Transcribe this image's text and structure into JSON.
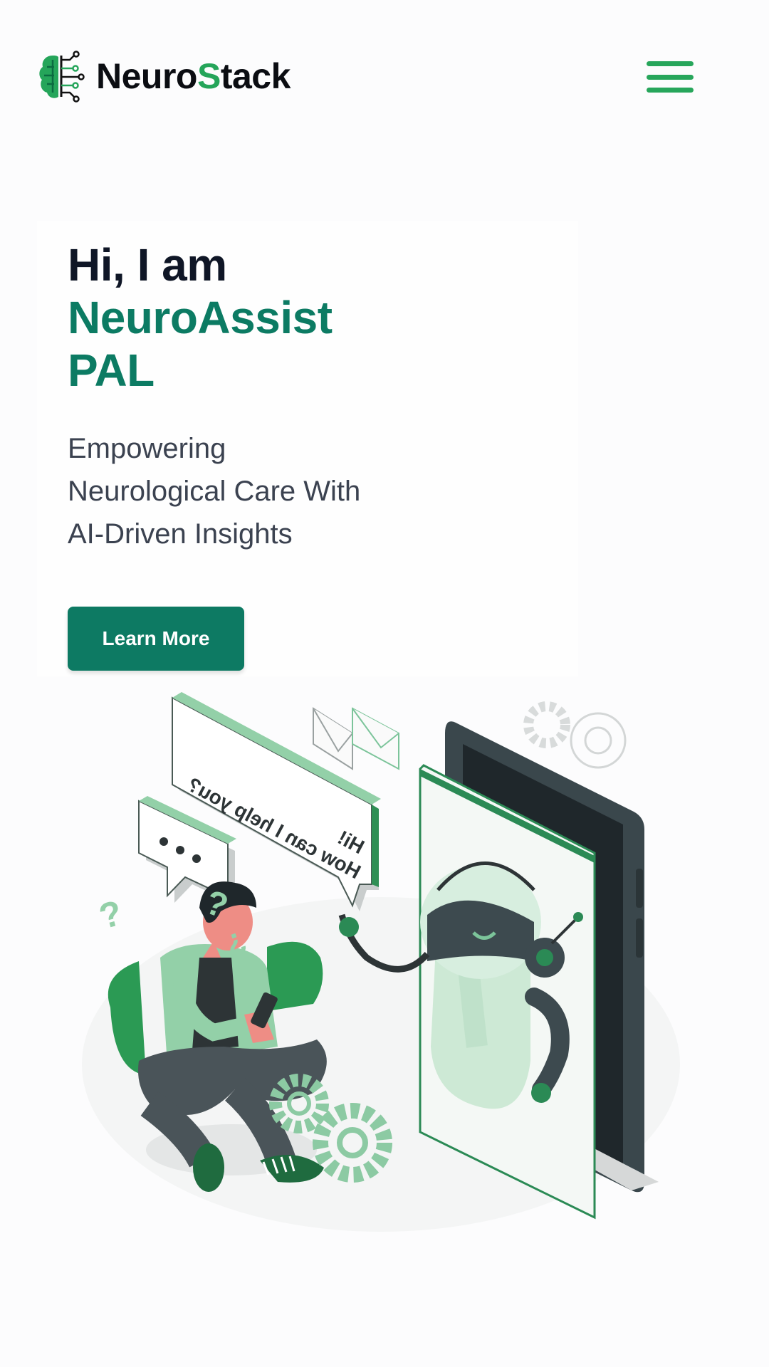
{
  "header": {
    "brand_prefix": "Neuro",
    "brand_s": "S",
    "brand_suffix": "tack",
    "logo_icon": "brain-circuit-icon",
    "menu_icon": "hamburger-menu-icon"
  },
  "hero": {
    "greeting": "Hi, I am",
    "name_line1": "NeuroAssist",
    "name_line2": "PAL",
    "subtitle_line1": "Empowering",
    "subtitle_line2": "Neurological Care With",
    "subtitle_line3": "AI-Driven Insights",
    "cta_label": "Learn More"
  },
  "illustration": {
    "bubble_line1": "Hi!",
    "bubble_line2": "How can I help you?"
  },
  "colors": {
    "brand_green": "#25a55a",
    "primary_teal": "#0c7b63",
    "title_dark": "#0f1626",
    "text_gray": "#3b4250"
  }
}
